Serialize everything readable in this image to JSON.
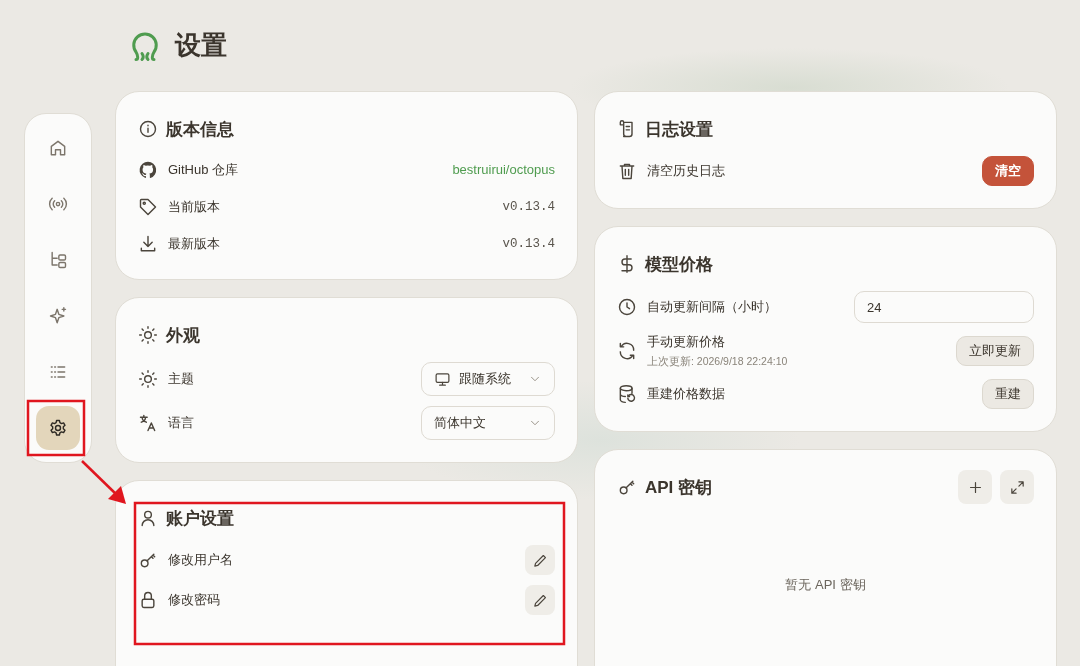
{
  "header": {
    "title": "设置"
  },
  "sidebar": {
    "items": [
      {
        "selected": false
      },
      {
        "selected": false
      },
      {
        "selected": false
      },
      {
        "selected": false
      },
      {
        "selected": false
      },
      {
        "selected": true
      }
    ]
  },
  "left_column": [
    {
      "kind": "settings",
      "title": "版本信息",
      "rows": [
        {
          "kind": "value",
          "label": "GitHub 仓库",
          "value": "bestruirui/octopus",
          "link": true
        },
        {
          "kind": "value",
          "label": "当前版本",
          "value": "v0.13.4",
          "link": false
        },
        {
          "kind": "value",
          "label": "最新版本",
          "value": "v0.13.4",
          "link": false
        }
      ]
    },
    {
      "kind": "settings",
      "title": "外观",
      "rows": [
        {
          "kind": "select",
          "label": "主题",
          "value": "跟随系统"
        },
        {
          "kind": "select",
          "label": "语言",
          "value": "简体中文"
        }
      ]
    },
    {
      "kind": "settings",
      "title": "账户设置",
      "rows": [
        {
          "kind": "edit",
          "label": "修改用户名"
        },
        {
          "kind": "edit",
          "label": "修改密码"
        }
      ]
    }
  ],
  "right_column": [
    {
      "kind": "settings",
      "title": "日志设置",
      "rows": [
        {
          "kind": "button",
          "label": "清空历史日志",
          "button": "清空",
          "danger": true
        }
      ]
    },
    {
      "kind": "settings",
      "title": "模型价格",
      "rows": [
        {
          "kind": "input",
          "label": "自动更新间隔（小时）",
          "value": "24"
        },
        {
          "kind": "button",
          "label": "手动更新价格",
          "note": "上次更新: 2026/9/18 22:24:10",
          "button": "立即更新",
          "danger": false
        },
        {
          "kind": "button",
          "label": "重建价格数据",
          "button": "重建",
          "danger": false
        }
      ]
    },
    {
      "kind": "list",
      "title": "API 密钥",
      "empty": "暂无 API 密钥"
    }
  ]
}
